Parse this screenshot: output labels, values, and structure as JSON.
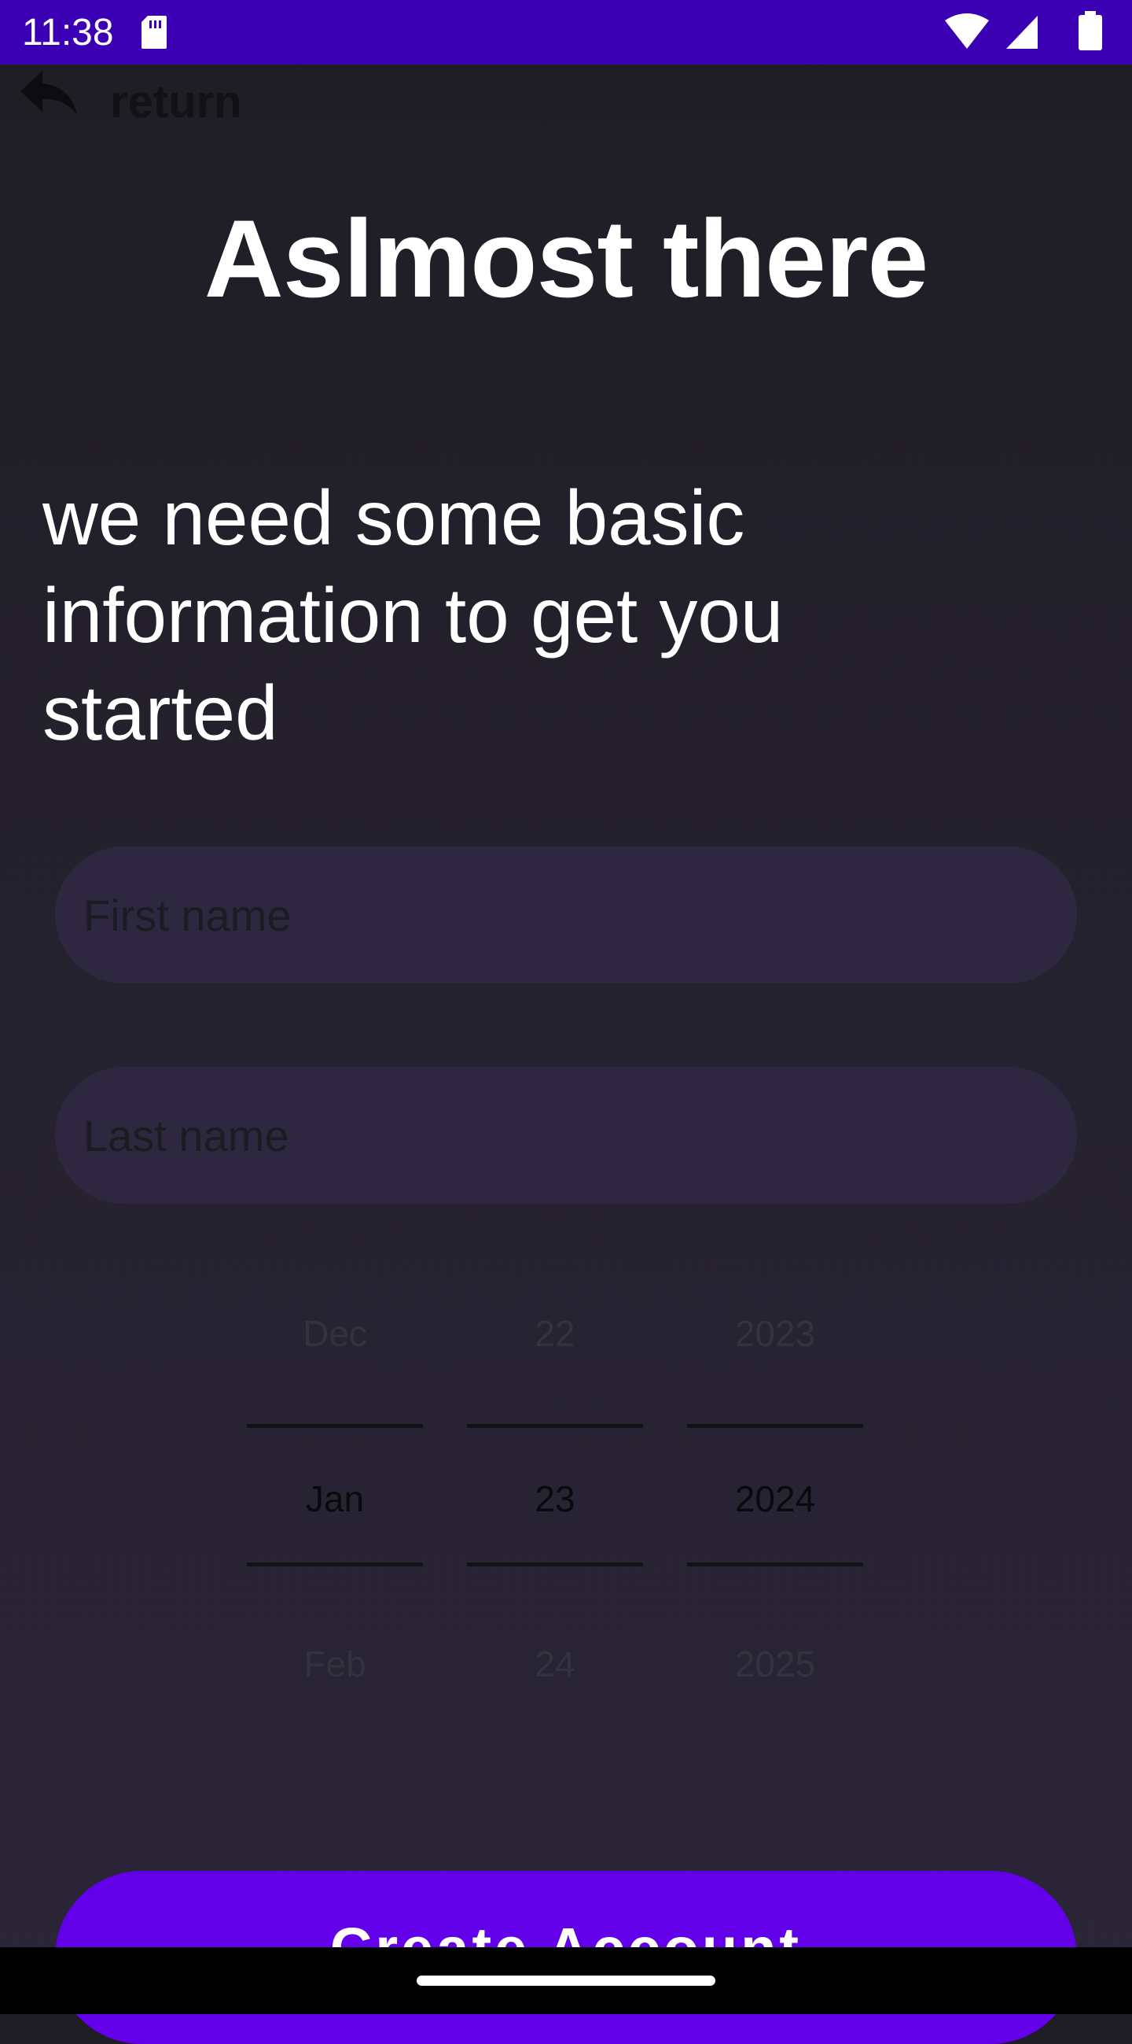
{
  "status_bar": {
    "time": "11:38",
    "icons": [
      "sd-card-icon",
      "wifi-icon",
      "cell-signal-icon",
      "battery-icon"
    ],
    "background": "#3b00b3"
  },
  "nav": {
    "return_label": "return",
    "return_icon": "reply-arrow-icon"
  },
  "header": {
    "title": "Aslmost there",
    "subtitle": "we need some basic information to get you started"
  },
  "form": {
    "first_name_placeholder": "First name",
    "first_name_value": "",
    "last_name_placeholder": "Last name",
    "last_name_value": "",
    "date_picker": {
      "month": {
        "prev": "Dec",
        "selected": "Jan",
        "next": "Feb"
      },
      "day": {
        "prev": "22",
        "selected": "23",
        "next": "24"
      },
      "year": {
        "prev": "2023",
        "selected": "2024",
        "next": "2025"
      }
    }
  },
  "actions": {
    "create_account_label": "Create Account",
    "accent": "#6200ea"
  }
}
